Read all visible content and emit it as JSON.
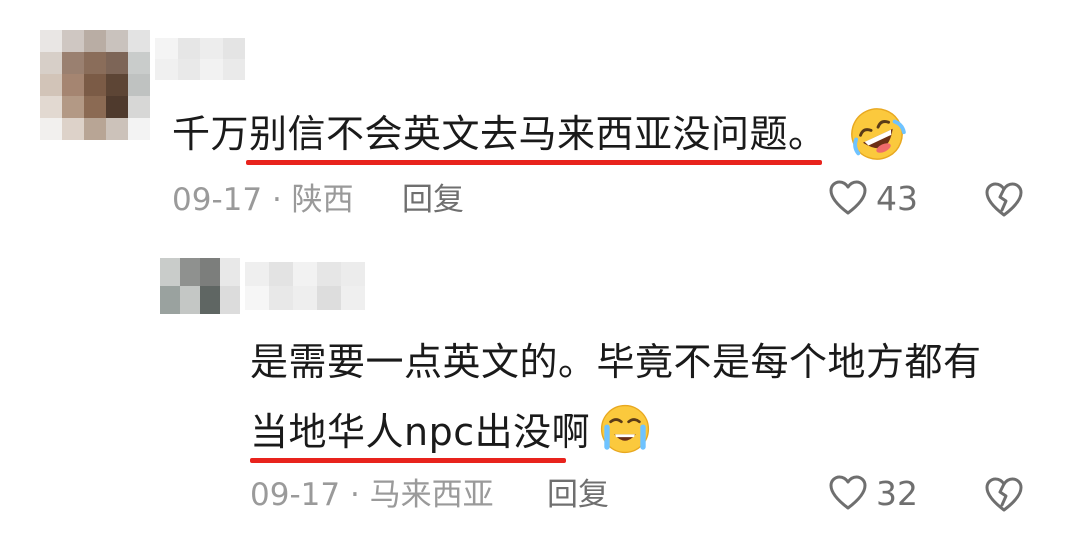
{
  "comments": [
    {
      "text": "千万别信不会英文去马来西亚没问题。",
      "date": "09-17",
      "separator": "·",
      "location": "陕西",
      "reply_label": "回复",
      "likes": "43",
      "emoji_icon": "rofl-emoji",
      "underline_color": "#e8231d"
    },
    {
      "line1": "是需要一点英文的。毕竟不是每个地方都有",
      "line2": "当地华人npc出没啊",
      "date": "09-17",
      "separator": "·",
      "location": "马来西亚",
      "reply_label": "回复",
      "likes": "32",
      "emoji_icon": "tearful-smile-emoji",
      "underline_color": "#e8231d"
    }
  ],
  "icons": {
    "like": "heart-outline-icon",
    "dislike": "broken-heart-icon"
  },
  "colors": {
    "text": "#1a1a1a",
    "meta": "#9a9a9a",
    "action": "#6f6f6f",
    "accent_underline": "#e8231d"
  }
}
